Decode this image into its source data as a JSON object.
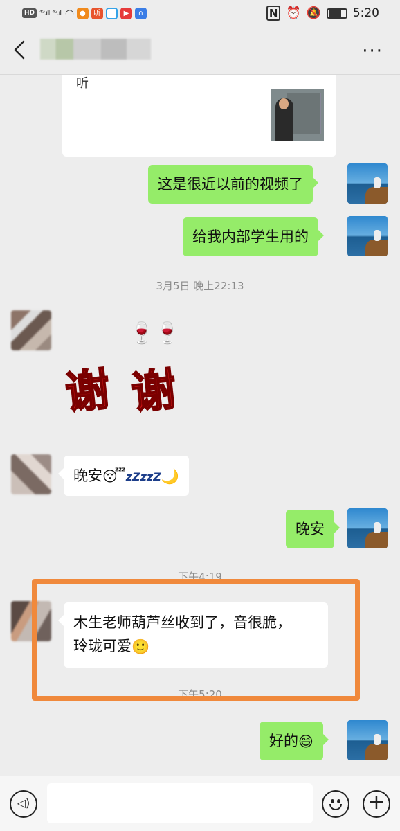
{
  "status_bar": {
    "hd": "HD",
    "signal_1": "⁴ᴳ.ıll",
    "signal_2": "⁴ᴳ.ıll",
    "app_ting": "听",
    "time": "5:20"
  },
  "header": {
    "back_icon": "chevron-left-icon",
    "more_label": "···"
  },
  "chat": {
    "card_text": "听",
    "messages": [
      {
        "from": "me",
        "text": "这是很近以前的视频了"
      },
      {
        "from": "me",
        "text": "给我内部学生用的"
      },
      {
        "from": "them",
        "text": "晚安",
        "emoji": "😴",
        "zzz": "zZzzZ",
        "moon": "🌙"
      },
      {
        "from": "me",
        "text": "晚安"
      },
      {
        "from": "them",
        "text_line1": "木生老师葫芦丝收到了，音很脆，",
        "text_line2": "玲珑可爱",
        "emoji": "🙂"
      },
      {
        "from": "me",
        "text": "好的",
        "emoji": "😄"
      }
    ],
    "timestamps": [
      "3月5日 晚上22:13",
      "下午4:19",
      "下午5:20"
    ],
    "sticker": {
      "char1": "谢",
      "char2": "谢",
      "glasses": "🍷🍷"
    }
  },
  "input_bar": {
    "voice_icon": "voice-icon",
    "emoji_icon": "emoji-icon",
    "plus_icon": "plus-icon",
    "voice_glyph": "◁)",
    "plus_glyph": "+"
  },
  "colors": {
    "my_bubble": "#95ec69",
    "their_bubble": "#ffffff",
    "highlight": "#f0893c",
    "background": "#ededed"
  }
}
